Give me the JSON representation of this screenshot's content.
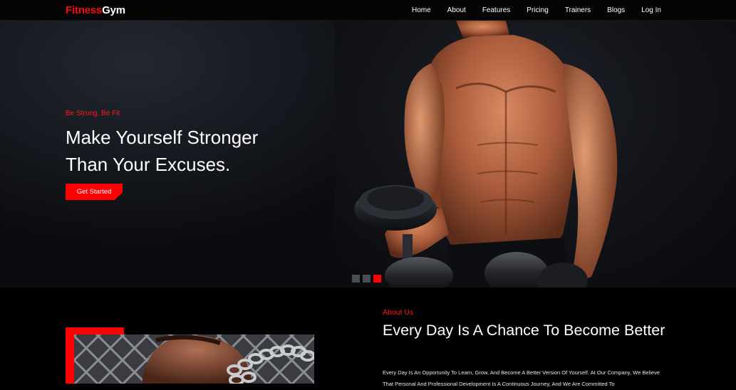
{
  "brand": {
    "part1": "Fitness",
    "part2": "Gym"
  },
  "nav": {
    "items": [
      "Home",
      "About",
      "Features",
      "Pricing",
      "Trainers",
      "Blogs",
      "Log In"
    ]
  },
  "hero": {
    "eyebrow": "Be Strong, Be Fit",
    "headline_line1": "Make Yourself Stronger",
    "headline_line2": "Than Your Excuses.",
    "cta_label": "Get Started",
    "slides": {
      "count": 3,
      "active_index": 2
    }
  },
  "about": {
    "eyebrow": "About Us",
    "title": "Every Day Is A Chance To Become Better",
    "text": "Every Day Is An Opportunity To Learn, Grow, And Become A Better Version Of Yourself. At Our Company, We Believe That Personal And Professional Development Is A Continuous Journey, And We Are Committed To"
  },
  "colors": {
    "accent": "#ff0000",
    "background": "#000000",
    "text": "#ffffff"
  }
}
